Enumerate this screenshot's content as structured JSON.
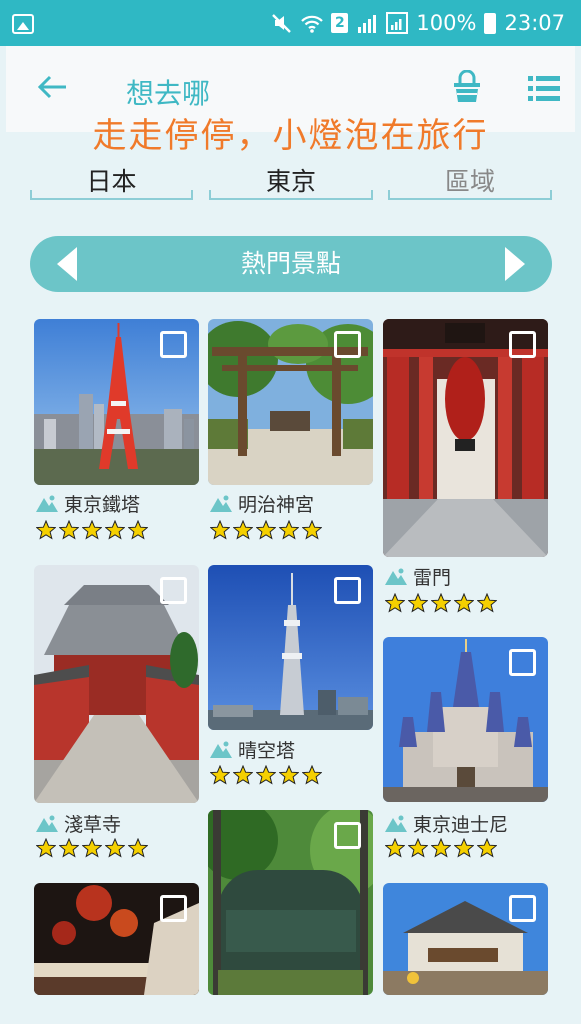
{
  "status": {
    "sim": "2",
    "battery": "100%",
    "time": "23:07"
  },
  "header": {
    "title": "想去哪",
    "slogan": "走走停停，小燈泡在旅行"
  },
  "selectors": {
    "country": "日本",
    "city": "東京",
    "area": "區域"
  },
  "category": {
    "label": "熱門景點"
  },
  "places": [
    {
      "name": "東京鐵塔",
      "rating": 5
    },
    {
      "name": "明治神宮",
      "rating": 5
    },
    {
      "name": "雷門",
      "rating": 5
    },
    {
      "name": "淺草寺",
      "rating": 5
    },
    {
      "name": "晴空塔",
      "rating": 5
    },
    {
      "name": "東京迪士尼",
      "rating": 5
    }
  ],
  "colors": {
    "statusbar": "#2fb8c4",
    "accent": "#3fb8c4",
    "slogan": "#f07a2a",
    "category_bar": "#6cc5c8",
    "star": "#f5d000"
  }
}
